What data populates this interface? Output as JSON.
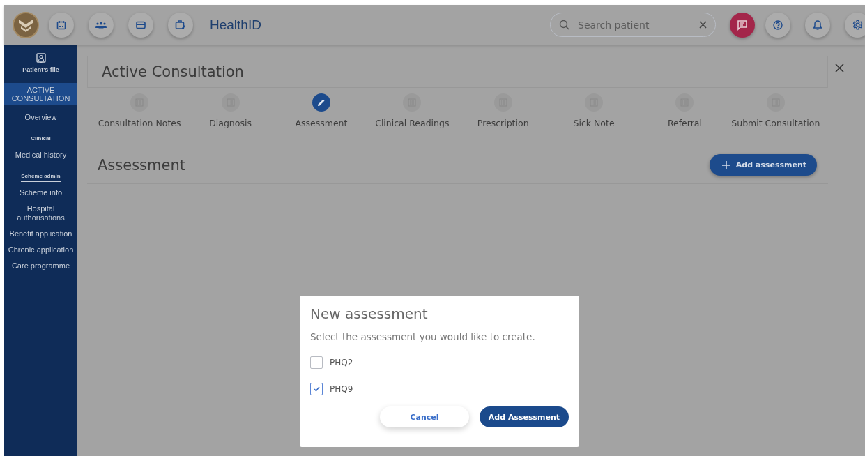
{
  "header": {
    "app_title": "HealthID",
    "search": {
      "placeholder": "Search patient"
    }
  },
  "sidebar": {
    "title": "Patient's file",
    "groups": [
      {
        "items": [
          {
            "label": "ACTIVE CONSULTATION",
            "selected": true
          },
          {
            "label": "Overview",
            "selected": false
          }
        ]
      },
      {
        "heading": "Clinical",
        "items": [
          {
            "label": "Medical history",
            "selected": false
          }
        ]
      },
      {
        "heading": "Scheme admin",
        "items": [
          {
            "label": "Scheme info",
            "selected": false
          },
          {
            "label": "Hospital authorisations",
            "selected": false
          },
          {
            "label": "Benefit application",
            "selected": false
          },
          {
            "label": "Chronic application",
            "selected": false
          },
          {
            "label": "Care programme",
            "selected": false
          }
        ]
      }
    ]
  },
  "consultation": {
    "title": "Active Consultation",
    "steps": [
      {
        "label": "Consultation Notes",
        "selected": false
      },
      {
        "label": "Diagnosis",
        "selected": false
      },
      {
        "label": "Assessment",
        "selected": true
      },
      {
        "label": "Clinical Readings",
        "selected": false
      },
      {
        "label": "Prescription",
        "selected": false
      },
      {
        "label": "Sick Note",
        "selected": false
      },
      {
        "label": "Referral",
        "selected": false
      },
      {
        "label": "Submit Consultation",
        "selected": false
      }
    ],
    "section": {
      "title": "Assessment",
      "add_button": "Add assessment"
    }
  },
  "dialog": {
    "title": "New assessment",
    "prompt": "Select the assessment you would like to create.",
    "options": [
      {
        "label": "PHQ2",
        "checked": false
      },
      {
        "label": "PHQ9",
        "checked": true
      }
    ],
    "buttons": [
      {
        "label": "Cancel",
        "kind": "secondary"
      },
      {
        "label": "Add Assessment",
        "kind": "primary"
      }
    ]
  }
}
